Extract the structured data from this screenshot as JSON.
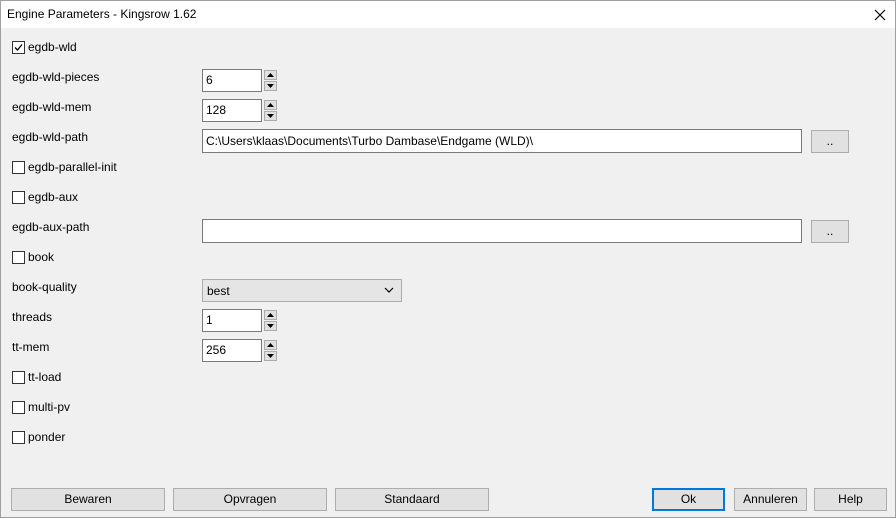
{
  "window": {
    "title": "Engine Parameters - Kingsrow 1.62"
  },
  "params": {
    "egdb_wld": {
      "label": "egdb-wld",
      "checked": true
    },
    "egdb_wld_pieces": {
      "label": "egdb-wld-pieces",
      "value": "6"
    },
    "egdb_wld_mem": {
      "label": "egdb-wld-mem",
      "value": "128"
    },
    "egdb_wld_path": {
      "label": "egdb-wld-path",
      "value": "C:\\Users\\klaas\\Documents\\Turbo Dambase\\Endgame (WLD)\\",
      "browse": ".."
    },
    "egdb_parallel_init": {
      "label": "egdb-parallel-init",
      "checked": false
    },
    "egdb_aux": {
      "label": "egdb-aux",
      "checked": false
    },
    "egdb_aux_path": {
      "label": "egdb-aux-path",
      "value": "",
      "browse": ".."
    },
    "book": {
      "label": "book",
      "checked": false
    },
    "book_quality": {
      "label": "book-quality",
      "value": "best"
    },
    "threads": {
      "label": "threads",
      "value": "1"
    },
    "tt_mem": {
      "label": "tt-mem",
      "value": "256"
    },
    "tt_load": {
      "label": "tt-load",
      "checked": false
    },
    "multi_pv": {
      "label": "multi-pv",
      "checked": false
    },
    "ponder": {
      "label": "ponder",
      "checked": false
    }
  },
  "buttons": {
    "save": "Bewaren",
    "query": "Opvragen",
    "standard": "Standaard",
    "ok": "Ok",
    "cancel": "Annuleren",
    "help": "Help"
  },
  "icons": {
    "close": "close-icon",
    "spin_up": "spin-up-icon",
    "spin_down": "spin-down-icon",
    "dropdown": "chevron-down-icon",
    "check": "checkmark-icon"
  },
  "colors": {
    "dialog_bg": "#f0f0f0",
    "button_face": "#e1e1e1",
    "default_button_border": "#0078d7"
  }
}
